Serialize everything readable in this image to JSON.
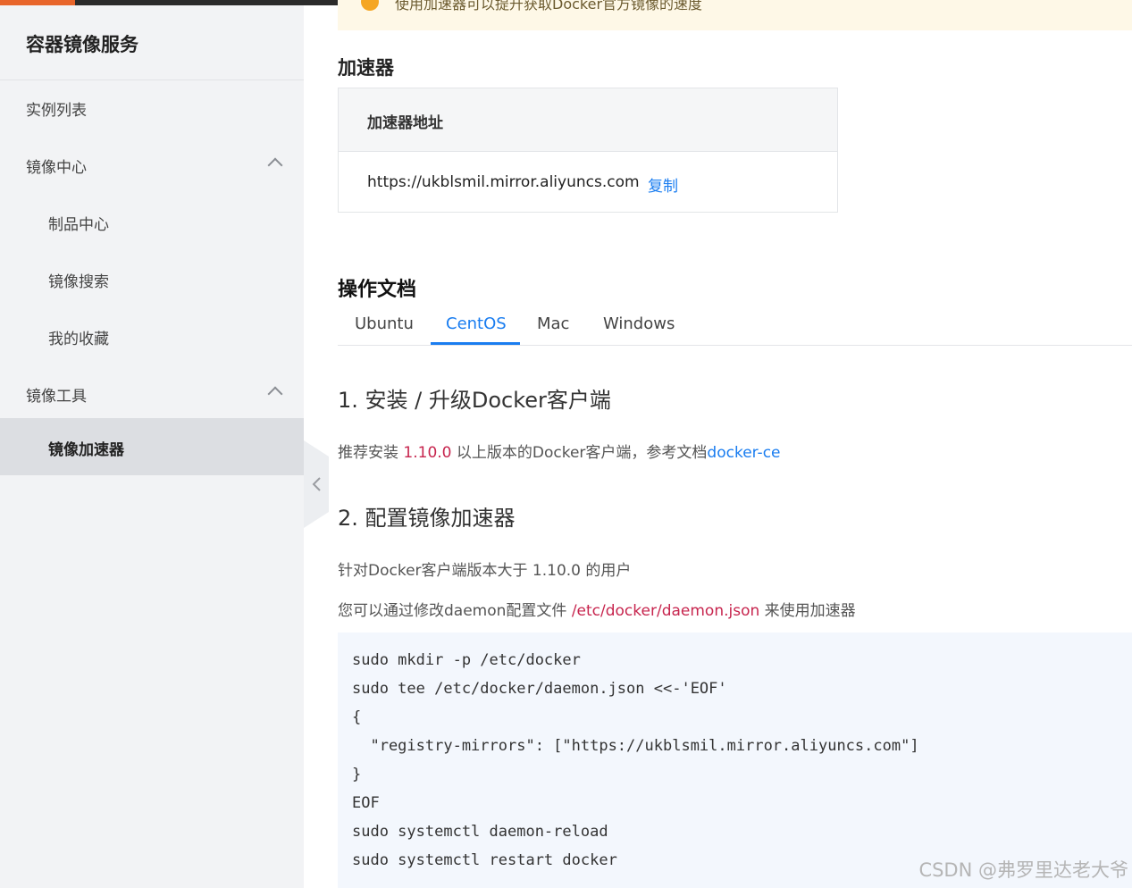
{
  "sidebar": {
    "title": "容器镜像服务",
    "items": [
      {
        "label": "实例列表"
      },
      {
        "label": "镜像中心"
      },
      {
        "label": "制品中心"
      },
      {
        "label": "镜像搜索"
      },
      {
        "label": "我的收藏"
      },
      {
        "label": "镜像工具"
      },
      {
        "label": "镜像加速器"
      }
    ]
  },
  "banner": {
    "text": "使用加速器可以提升获取Docker官方镜像的速度"
  },
  "accelerator": {
    "heading": "加速器",
    "address_label": "加速器地址",
    "url": "https://ukblsmil.mirror.aliyuncs.com",
    "copy_label": "复制"
  },
  "docs": {
    "heading": "操作文档",
    "tabs": [
      "Ubuntu",
      "CentOS",
      "Mac",
      "Windows"
    ],
    "active_tab": "CentOS",
    "step1": {
      "title": "1. 安装 / 升级Docker客户端",
      "text_before": "推荐安装 ",
      "version": "1.10.0",
      "text_mid": " 以上版本的Docker客户端，参考文档",
      "link": "docker-ce"
    },
    "step2": {
      "title": "2. 配置镜像加速器",
      "line1": "针对Docker客户端版本大于 1.10.0 的用户",
      "line2_before": "您可以通过修改daemon配置文件 ",
      "line2_path": "/etc/docker/daemon.json",
      "line2_after": " 来使用加速器"
    },
    "code_lines": [
      "sudo mkdir -p /etc/docker",
      "sudo tee /etc/docker/daemon.json <<-'EOF'",
      "{",
      "  \"registry-mirrors\": [\"https://ukblsmil.mirror.aliyuncs.com\"]",
      "}",
      "EOF",
      "sudo systemctl daemon-reload",
      "sudo systemctl restart docker"
    ]
  },
  "watermark": "CSDN @弗罗里达老大爷",
  "colors": {
    "accent": "#1a7df0",
    "code_red": "#c7254e",
    "sidebar_bg": "#f2f3f5",
    "active_bg": "#dcdee2"
  }
}
